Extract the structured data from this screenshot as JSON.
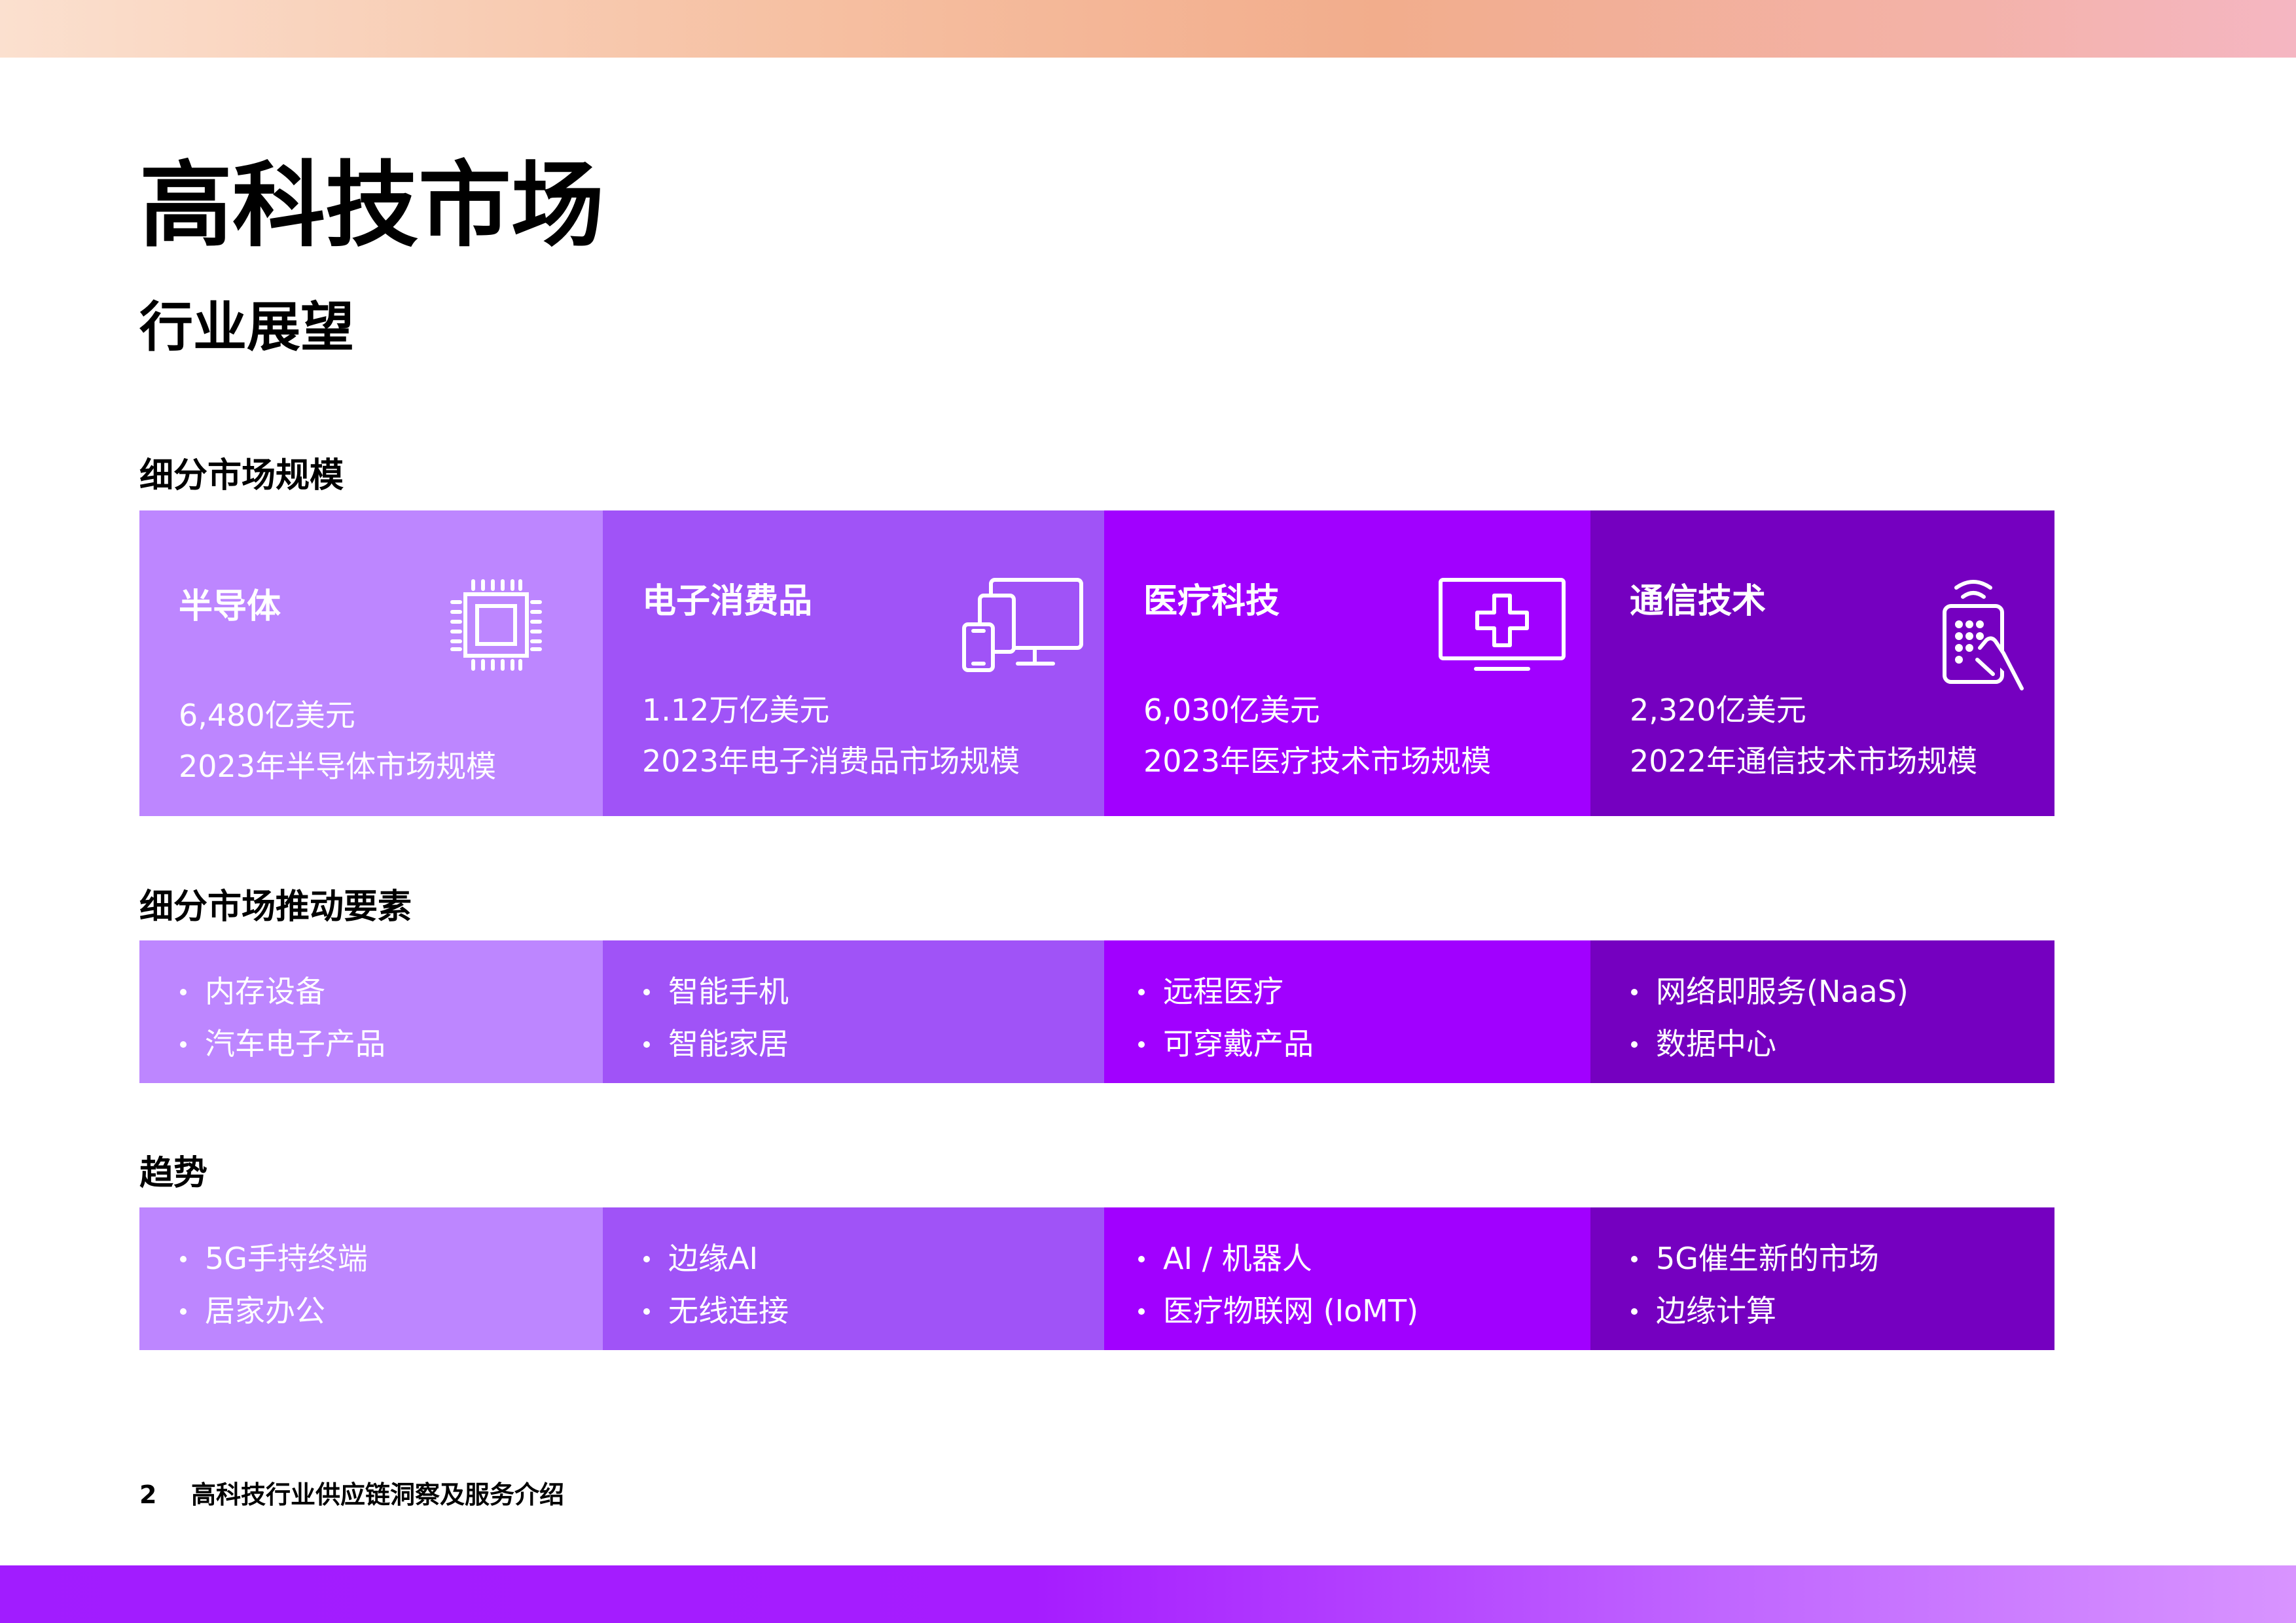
{
  "header": {
    "title": "高科技市场",
    "subtitle": "行业展望"
  },
  "sections": {
    "market_size": {
      "label": "细分市场规模",
      "cells": [
        {
          "title": "半导体",
          "value": "6,480亿美元",
          "desc": "2023年半导体市场规模",
          "icon": "chip-icon"
        },
        {
          "title": "电子消费品",
          "value": "1.12万亿美元",
          "desc": "2023年电子消费品市场规模",
          "icon": "devices-icon"
        },
        {
          "title": "医疗科技",
          "value": "6,030亿美元",
          "desc": "2023年医疗技术市场规模",
          "icon": "medical-monitor-icon"
        },
        {
          "title": "通信技术",
          "value": "2,320亿美元",
          "desc": "2022年通信技术市场规模",
          "icon": "wireless-remote-icon"
        }
      ]
    },
    "drivers": {
      "label": "细分市场推动要素",
      "cells": [
        {
          "items": [
            "内存设备",
            "汽车电子产品"
          ]
        },
        {
          "items": [
            "智能手机",
            "智能家居"
          ]
        },
        {
          "items": [
            "远程医疗",
            "可穿戴产品"
          ]
        },
        {
          "items": [
            "网络即服务(NaaS)",
            "数据中心"
          ]
        }
      ]
    },
    "trends": {
      "label": "趋势",
      "cells": [
        {
          "items": [
            "5G手持终端",
            "居家办公"
          ]
        },
        {
          "items": [
            "边缘AI",
            "无线连接"
          ]
        },
        {
          "items": [
            "AI / 机器人",
            "医疗物联网 (IoMT)"
          ]
        },
        {
          "items": [
            "5G催生新的市场",
            "边缘计算"
          ]
        }
      ]
    }
  },
  "footer": {
    "page_number": "2",
    "doc_title": "高科技行业供应链洞察及服务介绍"
  },
  "colors": {
    "cell_1": "#bd86ff",
    "cell_2": "#a053f7",
    "cell_3": "#a100ff",
    "cell_4": "#7500c0"
  }
}
